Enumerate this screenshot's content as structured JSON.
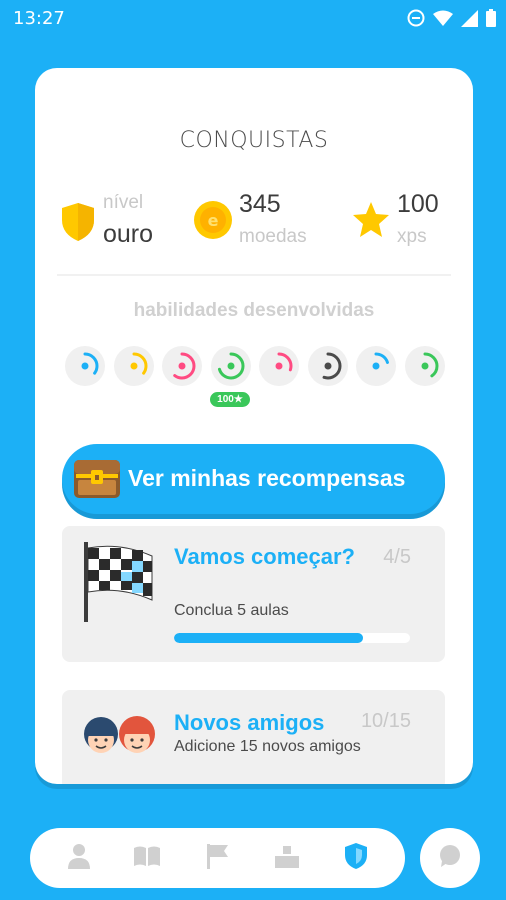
{
  "status_bar": {
    "time": "13:27",
    "icons": [
      "do-not-disturb-icon",
      "wifi-icon",
      "signal-icon",
      "battery-icon"
    ]
  },
  "achievements_card": {
    "title": "CONQUISTAS",
    "stats": [
      {
        "icon": "shield-icon",
        "label": "nível",
        "value": "ouro"
      },
      {
        "icon": "coin-icon",
        "label": "moedas",
        "value": "345"
      },
      {
        "icon": "star-icon",
        "label": "xps",
        "value": "100"
      }
    ],
    "skills": {
      "title": "habilidades desenvolvidas",
      "items": [
        {
          "icon": "skill-1-icon",
          "color": "#1cb0f6",
          "progress": 0.35
        },
        {
          "icon": "skill-2-icon",
          "color": "#ffc800",
          "progress": 0.35
        },
        {
          "icon": "skill-3-icon",
          "color": "#ff4b82",
          "progress": 0.6
        },
        {
          "icon": "skill-4-icon",
          "color": "#3ac75a",
          "progress": 0.7
        },
        {
          "icon": "skill-5-icon",
          "color": "#ff4b82",
          "progress": 0.3
        },
        {
          "icon": "skill-6-icon",
          "color": "#4b4b4b",
          "progress": 0.55
        },
        {
          "icon": "skill-7-icon",
          "color": "#1cb0f6",
          "progress": 0.2
        },
        {
          "icon": "skill-8-icon",
          "color": "#3ac75a",
          "progress": 0.4
        }
      ],
      "badge": "100"
    },
    "rewards_button": {
      "label": "Ver minhas recompensas",
      "icon": "treasure-chest-icon"
    },
    "achievements": [
      {
        "icon": "checkered-flag-icon",
        "name": "Vamos começar?",
        "progress_text": "4/5",
        "description": "Conclua 5 aulas",
        "progress": 0.8
      },
      {
        "icon": "friends-icon",
        "name": "Novos amigos",
        "progress_text": "10/15",
        "description": "Adicione 15 novos amigos"
      }
    ]
  },
  "bottom_nav": {
    "items": [
      {
        "icon": "profile-icon",
        "active": false
      },
      {
        "icon": "book-icon",
        "active": false
      },
      {
        "icon": "flag-icon",
        "active": false
      },
      {
        "icon": "leaderboard-icon",
        "active": false
      },
      {
        "icon": "shield-icon",
        "active": true
      }
    ],
    "chat": {
      "icon": "chat-bubble-icon"
    }
  },
  "colors": {
    "accent": "#1cb0f6",
    "inactive_icon": "#d0d0d0",
    "success": "#3ac75a"
  }
}
